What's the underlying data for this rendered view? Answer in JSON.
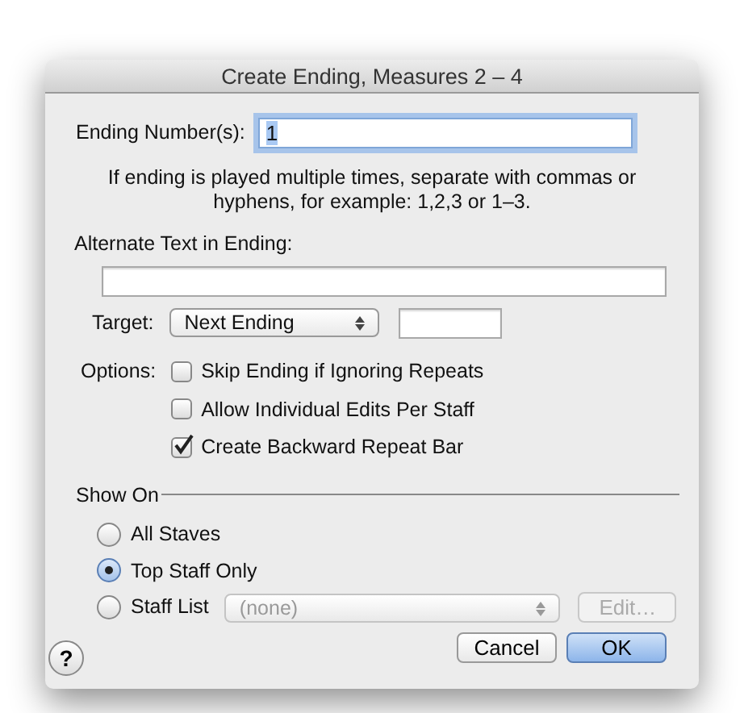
{
  "window": {
    "title": "Create Ending, Measures 2 – 4"
  },
  "ending_numbers": {
    "label": "Ending Number(s):",
    "value": "1",
    "focused": true
  },
  "help_text": "If ending is played multiple times, separate with commas or hyphens, for example: 1,2,3 or 1–3.",
  "alternate_text": {
    "label": "Alternate Text in Ending:"
  },
  "target": {
    "label": "Target:",
    "value": "Next Ending"
  },
  "options": {
    "label": "Options:",
    "items": [
      {
        "label": "Skip Ending if Ignoring Repeats",
        "checked": false
      },
      {
        "label": "Allow Individual Edits Per Staff",
        "checked": false
      },
      {
        "label": "Create Backward Repeat Bar",
        "checked": true
      }
    ]
  },
  "show_on": {
    "label": "Show On",
    "items": [
      {
        "label": "All Staves",
        "selected": false
      },
      {
        "label": "Top Staff Only",
        "selected": true
      },
      {
        "label": "Staff List",
        "selected": false
      }
    ]
  },
  "staff_list": {
    "value": "(none)",
    "disabled": true
  },
  "edit_button": {
    "label": "Edit…",
    "disabled": true
  },
  "help_button": "?",
  "buttons": [
    {
      "label": "Cancel",
      "default": false
    },
    {
      "label": "OK",
      "default": true
    }
  ]
}
